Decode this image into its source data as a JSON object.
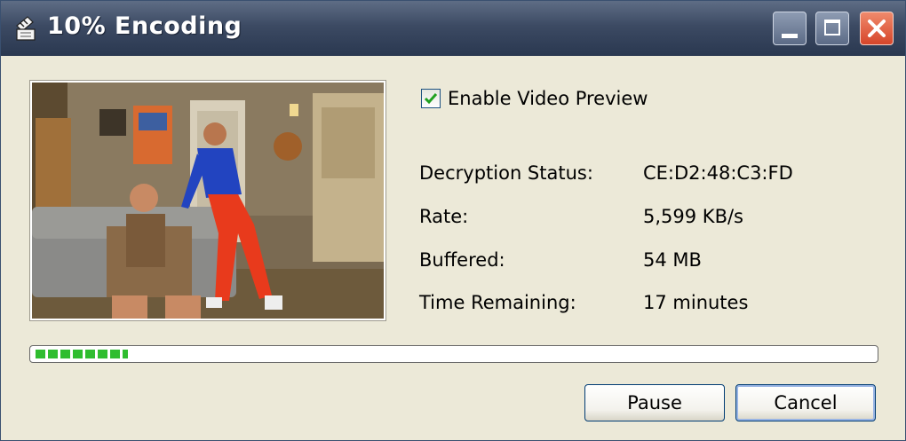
{
  "window": {
    "title": "10% Encoding",
    "controls": {
      "minimize": "minimize",
      "maximize": "maximize",
      "close": "close"
    }
  },
  "preview": {
    "enable_label": "Enable Video Preview",
    "enabled": true
  },
  "status": {
    "decryption_label": "Decryption Status:",
    "decryption_value": "CE:D2:48:C3:FD",
    "rate_label": "Rate:",
    "rate_value": "5,599 KB/s",
    "buffered_label": "Buffered:",
    "buffered_value": "54 MB",
    "remaining_label": "Time Remaining:",
    "remaining_value": "17 minutes"
  },
  "progress": {
    "fraction": 0.11
  },
  "buttons": {
    "pause": "Pause",
    "cancel": "Cancel"
  },
  "colors": {
    "titlebar": "#3c4a63",
    "progress": "#2fbd2f",
    "close": "#d6452a",
    "dialog_bg": "#ece9d8"
  }
}
